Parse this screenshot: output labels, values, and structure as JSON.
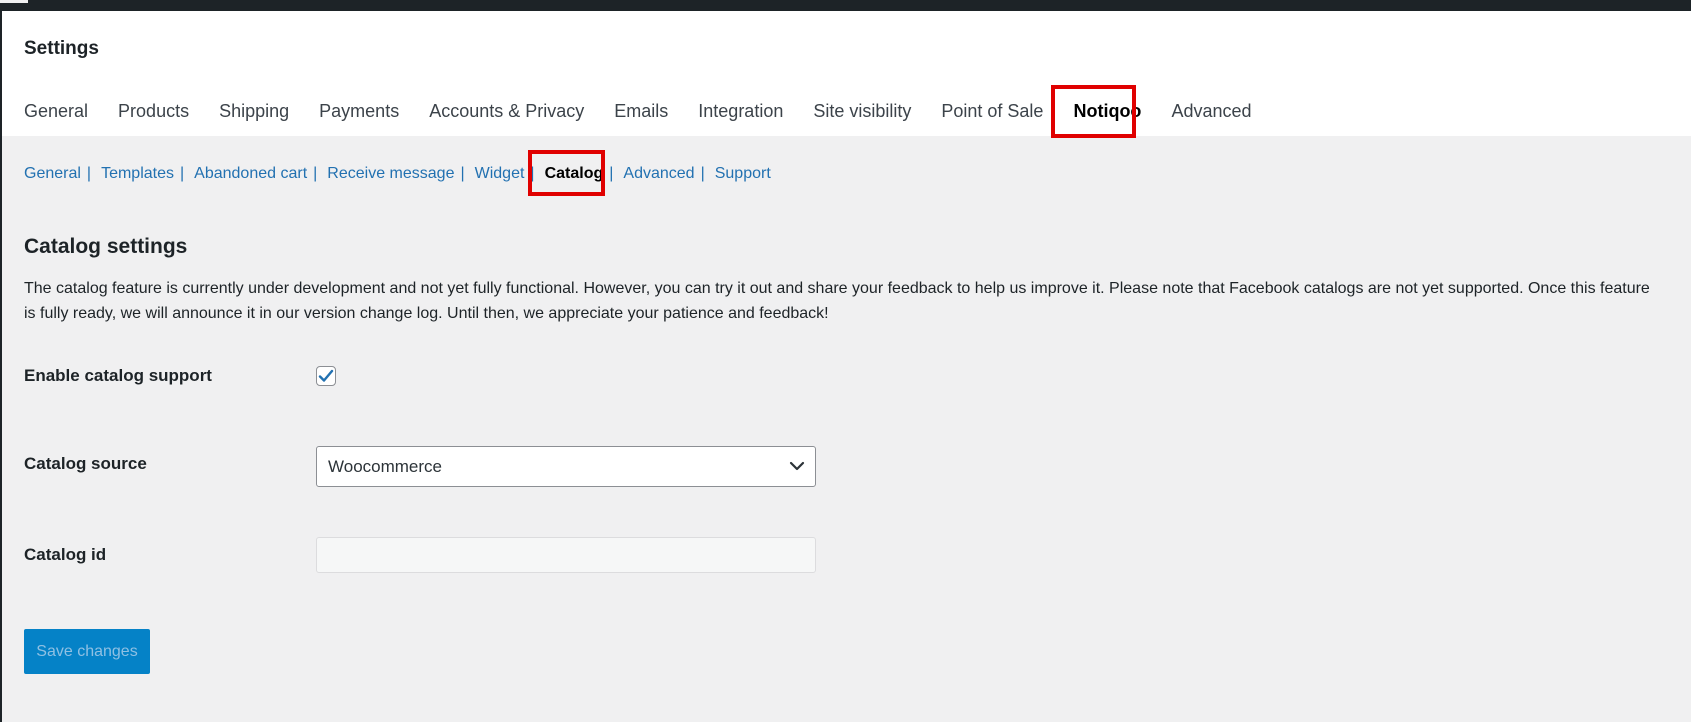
{
  "page": {
    "title": "Settings"
  },
  "tabs": [
    {
      "label": "General"
    },
    {
      "label": "Products"
    },
    {
      "label": "Shipping"
    },
    {
      "label": "Payments"
    },
    {
      "label": "Accounts & Privacy"
    },
    {
      "label": "Emails"
    },
    {
      "label": "Integration"
    },
    {
      "label": "Site visibility"
    },
    {
      "label": "Point of Sale"
    },
    {
      "label": "Notiqoo",
      "active": true
    },
    {
      "label": "Advanced"
    }
  ],
  "subnav": [
    {
      "label": "General"
    },
    {
      "label": "Templates"
    },
    {
      "label": "Abandoned cart"
    },
    {
      "label": "Receive message"
    },
    {
      "label": "Widget"
    },
    {
      "label": "Catalog",
      "current": true
    },
    {
      "label": "Advanced"
    },
    {
      "label": "Support"
    }
  ],
  "section": {
    "title": "Catalog settings",
    "description": "The catalog feature is currently under development and not yet fully functional. However, you can try it out and share your feedback to help us improve it. Please note that Facebook catalogs are not yet supported. Once this feature is fully ready, we will announce it in our version change log. Until then, we appreciate your patience and feedback!"
  },
  "fields": {
    "enable_catalog": {
      "label": "Enable catalog support",
      "checked": true
    },
    "catalog_source": {
      "label": "Catalog source",
      "value": "Woocommerce"
    },
    "catalog_id": {
      "label": "Catalog id",
      "value": ""
    }
  },
  "save_button": {
    "label": "Save changes"
  },
  "colors": {
    "highlight": "#e00000",
    "link": "#2271b1",
    "button": "#0582c7",
    "checkmark": "#2271b1"
  },
  "icons": {
    "checkbox": "check-icon",
    "select": "chevron-down-icon"
  }
}
